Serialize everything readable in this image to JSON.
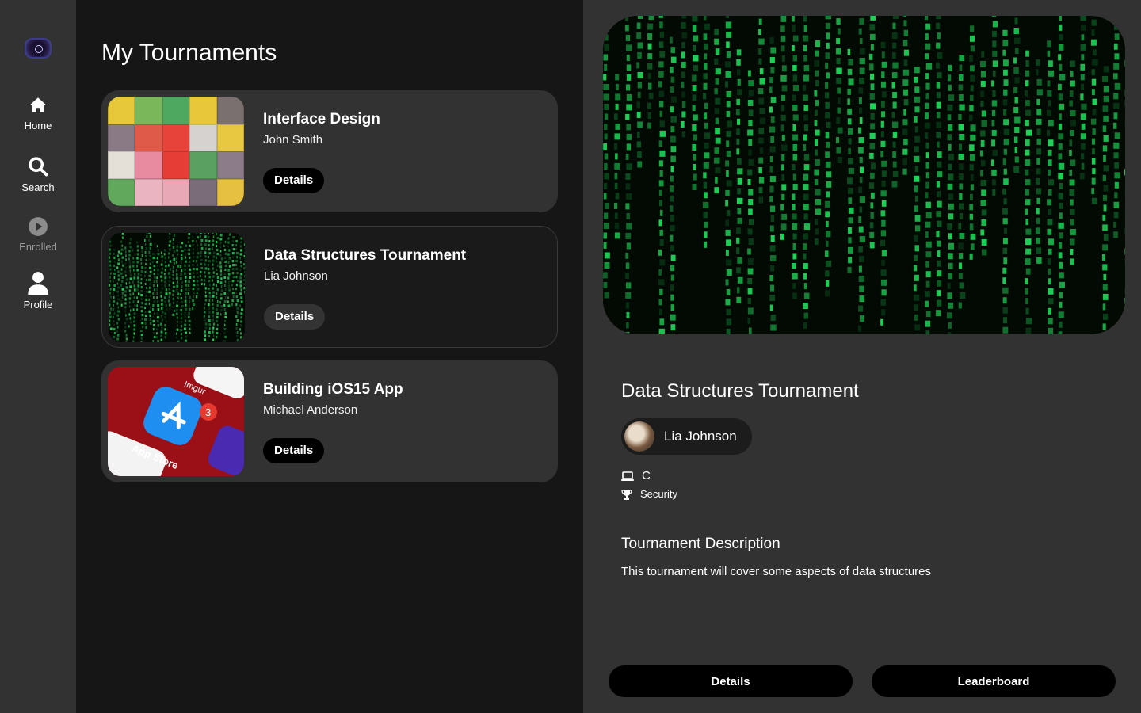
{
  "sidebar": {
    "logo": "app-logo",
    "items": [
      {
        "label": "Home",
        "icon": "home-icon"
      },
      {
        "label": "Search",
        "icon": "search-icon"
      },
      {
        "label": "Enrolled",
        "icon": "play-circle-icon"
      },
      {
        "label": "Profile",
        "icon": "person-icon"
      }
    ]
  },
  "main": {
    "title": "My Tournaments",
    "tournaments": [
      {
        "title": "Interface Design",
        "author": "John Smith",
        "button": "Details",
        "image": "puzzle-image"
      },
      {
        "title": "Data Structures Tournament",
        "author": "Lia Johnson",
        "button": "Details",
        "image": "matrix-code-image"
      },
      {
        "title": "Building iOS15 App",
        "author": "Michael Anderson",
        "button": "Details",
        "image": "app-store-image"
      }
    ]
  },
  "detail": {
    "title": "Data Structures Tournament",
    "owner": "Lia Johnson",
    "language": "C",
    "category": "Security",
    "description_heading": "Tournament Description",
    "description": "This tournament will cover some aspects of data structures",
    "details_button": "Details",
    "leaderboard_button": "Leaderboard"
  },
  "colors": {
    "sidebar_bg": "#323232",
    "main_bg": "#161616",
    "card_bg": "#323232",
    "button_bg": "#000000",
    "matrix_green": "#1fd65a"
  }
}
